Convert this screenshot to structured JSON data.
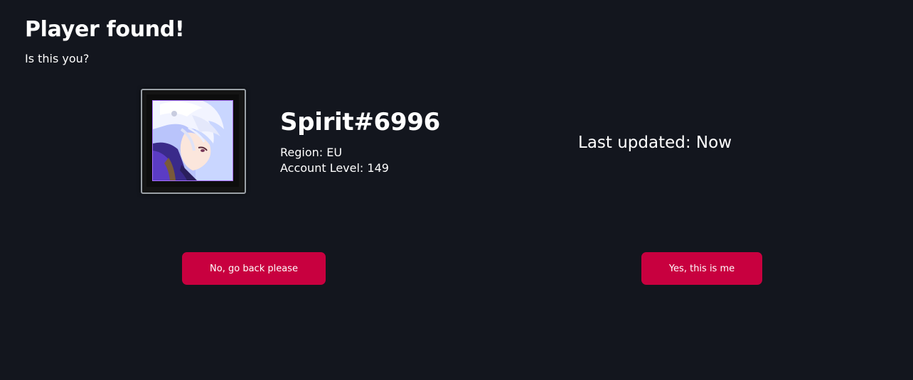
{
  "header": {
    "title": "Player found!",
    "subtitle": "Is this you?"
  },
  "player": {
    "name": "Spirit#6996",
    "region": "Region: EU",
    "account_level": "Account Level: 149",
    "last_updated": "Last updated: Now"
  },
  "actions": {
    "no_label": "No, go back please",
    "yes_label": "Yes, this is me"
  },
  "colors": {
    "background": "#13161e",
    "accent": "#c8003f",
    "text": "#ffffff",
    "avatar_border": "#a970ff"
  }
}
